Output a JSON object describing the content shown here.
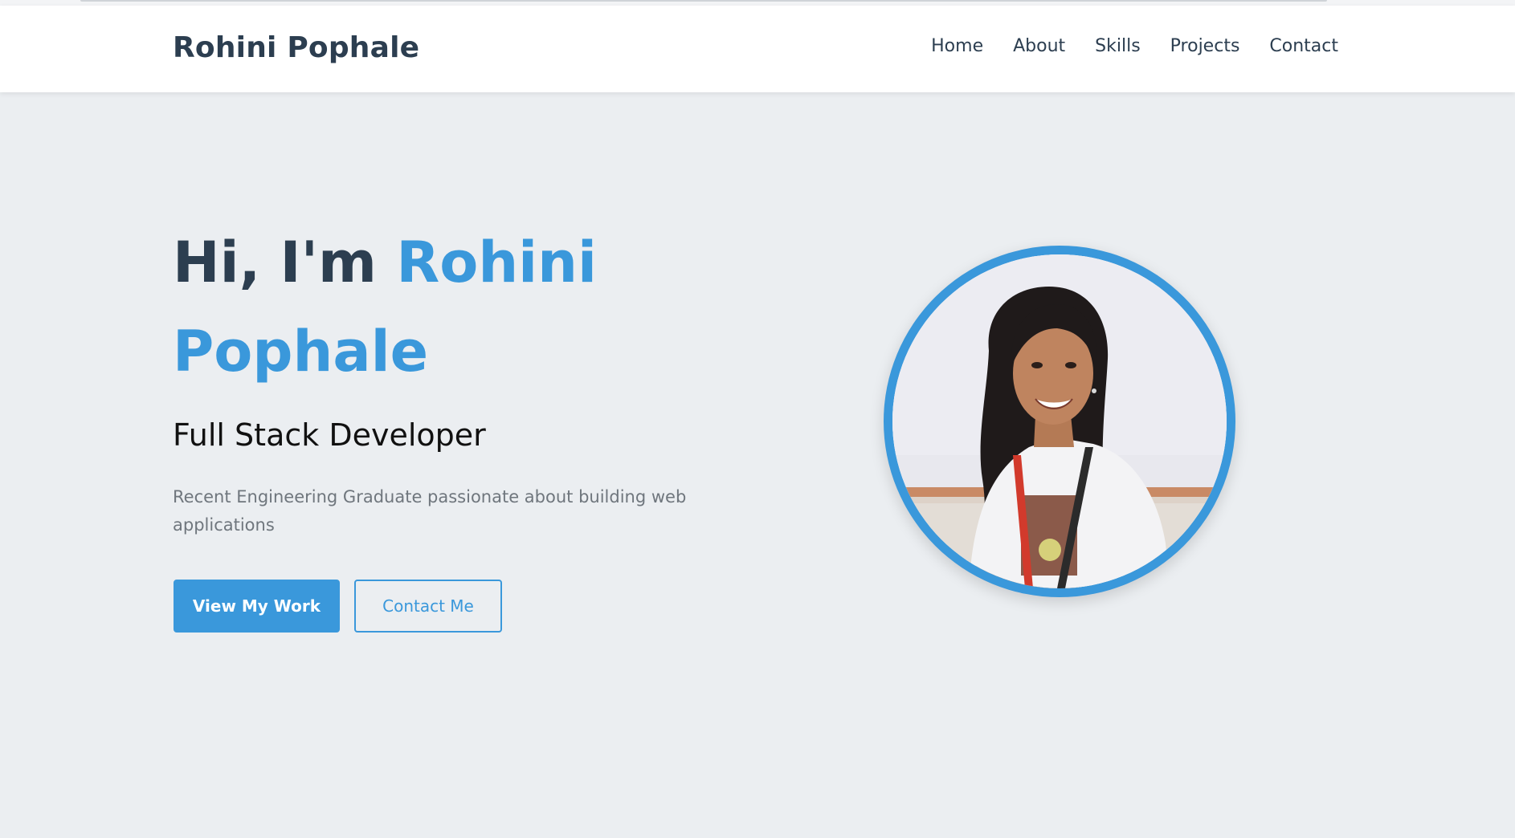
{
  "header": {
    "brand": "Rohini Pophale",
    "nav": [
      "Home",
      "About",
      "Skills",
      "Projects",
      "Contact"
    ]
  },
  "hero": {
    "greeting": "Hi, I'm",
    "name_first": "Rohini",
    "name_last": "Pophale",
    "role": "Full Stack Developer",
    "description": "Recent Engineering Graduate passionate about building web applications",
    "primary_button": "View My Work",
    "secondary_button": "Contact Me"
  },
  "colors": {
    "accent": "#3a98db",
    "heading": "#2c3e50",
    "background": "#ebeef1",
    "muted_text": "#6f767d"
  },
  "icons": {
    "profile": "profile-photo"
  }
}
